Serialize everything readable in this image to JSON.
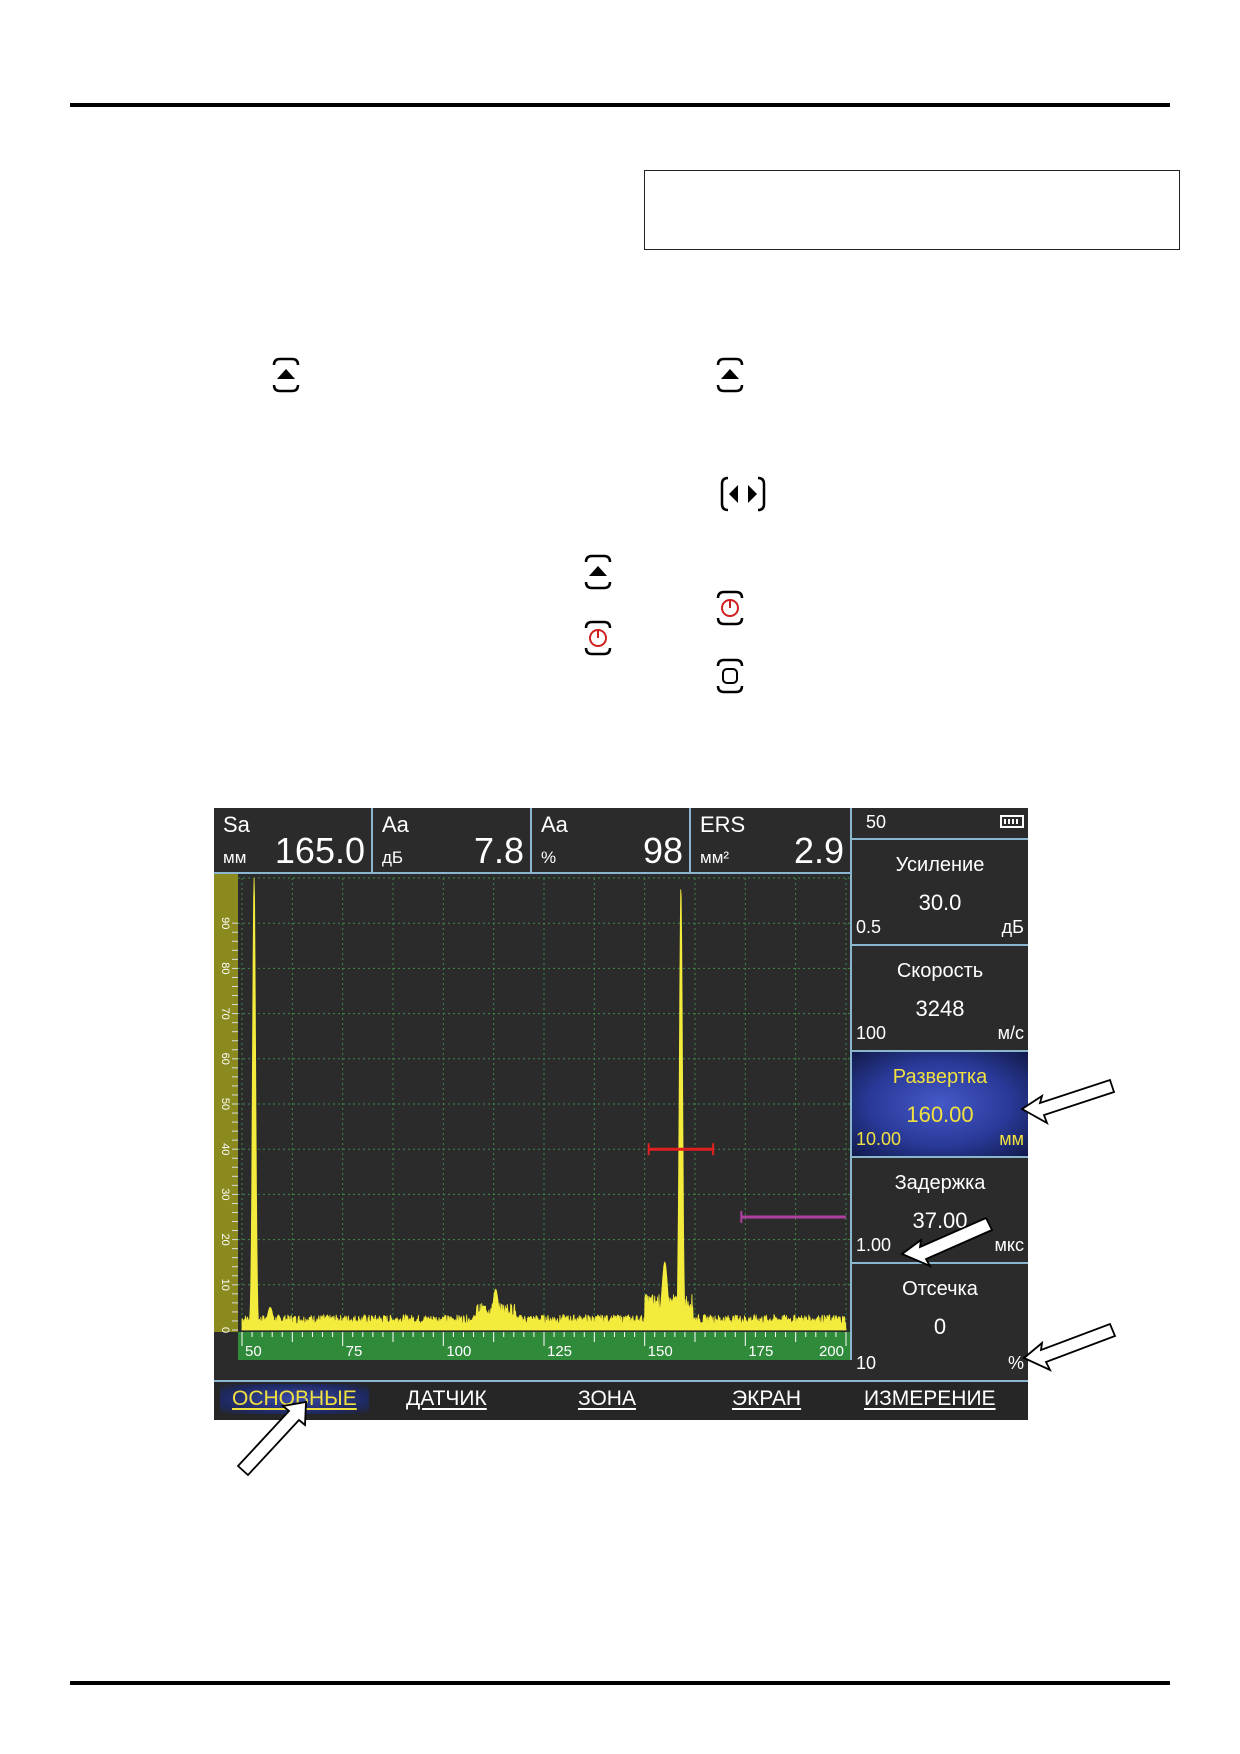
{
  "screen": {
    "header": [
      {
        "name": "Sa",
        "unit": "мм",
        "value": "165.0"
      },
      {
        "name": "Aa",
        "unit": "дБ",
        "value": "7.8"
      },
      {
        "name": "Aa",
        "unit": "%",
        "value": "98"
      },
      {
        "name": "ERS",
        "unit": "мм²",
        "value": "2.9"
      }
    ],
    "status": {
      "value": "50",
      "battery_icon": "battery-icon"
    },
    "params": [
      {
        "title": "Усиление",
        "value": "30.0",
        "step": "0.5",
        "unit": "дБ"
      },
      {
        "title": "Скорость",
        "value": "3248",
        "step": "100",
        "unit": "м/с"
      },
      {
        "title": "Развертка",
        "value": "160.00",
        "step": "10.00",
        "unit": "мм",
        "selected": true
      },
      {
        "title": "Задержка",
        "value": "37.00",
        "step": "1.00",
        "unit": "мкс"
      },
      {
        "title": "Отсечка",
        "value": "0",
        "step": "10",
        "unit": "%"
      }
    ],
    "tabs": [
      "ОСНОВНЫЕ",
      "ДАТЧИК",
      "ЗОНА",
      "ЭКРАН",
      "ИЗМЕРЕНИЕ"
    ],
    "active_tab": "ОСНОВНЫЕ",
    "colors": {
      "signal": "#f4ec3c",
      "scale_green": "#2f8a3a",
      "scale_olive": "#8a8a1e",
      "gate_a": "#e02020",
      "gate_b": "#b040a0",
      "frame": "#8ab6d0",
      "selected": "#2f3fb0"
    }
  },
  "chart_data": {
    "type": "area",
    "x_range": [
      50,
      200
    ],
    "y_range": [
      0,
      100
    ],
    "x_ticks": [
      50,
      75,
      100,
      125,
      150,
      175,
      200
    ],
    "y_ticks": [
      0,
      10,
      20,
      30,
      40,
      50,
      60,
      70,
      80,
      90
    ],
    "grid": true,
    "peaks": [
      {
        "x": 53,
        "amplitude": 100
      },
      {
        "x": 57,
        "amplitude": 5
      },
      {
        "x": 113,
        "amplitude": 9
      },
      {
        "x": 155,
        "amplitude": 15
      },
      {
        "x": 159,
        "amplitude": 98
      }
    ],
    "gate_a": {
      "start": 151,
      "end": 167,
      "level": 40
    },
    "gate_b": {
      "start": 174,
      "end": 200,
      "level": 25
    }
  }
}
